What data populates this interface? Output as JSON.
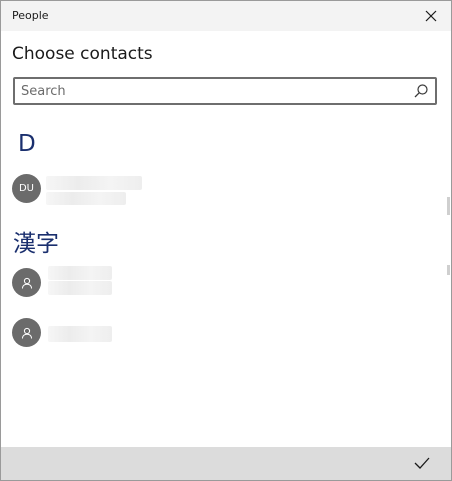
{
  "window": {
    "title": "People"
  },
  "heading": "Choose contacts",
  "search": {
    "placeholder": "Search",
    "value": ""
  },
  "groups": [
    {
      "letter": "D",
      "contacts": [
        {
          "initials": "DU",
          "avatar_icon": ""
        }
      ]
    },
    {
      "letter": "漢字",
      "contacts": [
        {
          "initials": "",
          "avatar_icon": "person-icon"
        },
        {
          "initials": "",
          "avatar_icon": "person-icon"
        }
      ]
    }
  ],
  "icons": {
    "close": "close-icon",
    "search": "search-icon",
    "accept": "checkmark-icon",
    "person": "person-icon"
  },
  "colors": {
    "titlebar_bg": "#f3f3f3",
    "footer_bg": "#dcdcdc",
    "avatar_bg": "#6b6b6b",
    "group_header": "#1a2f6e",
    "search_border": "#6e6e6e"
  }
}
